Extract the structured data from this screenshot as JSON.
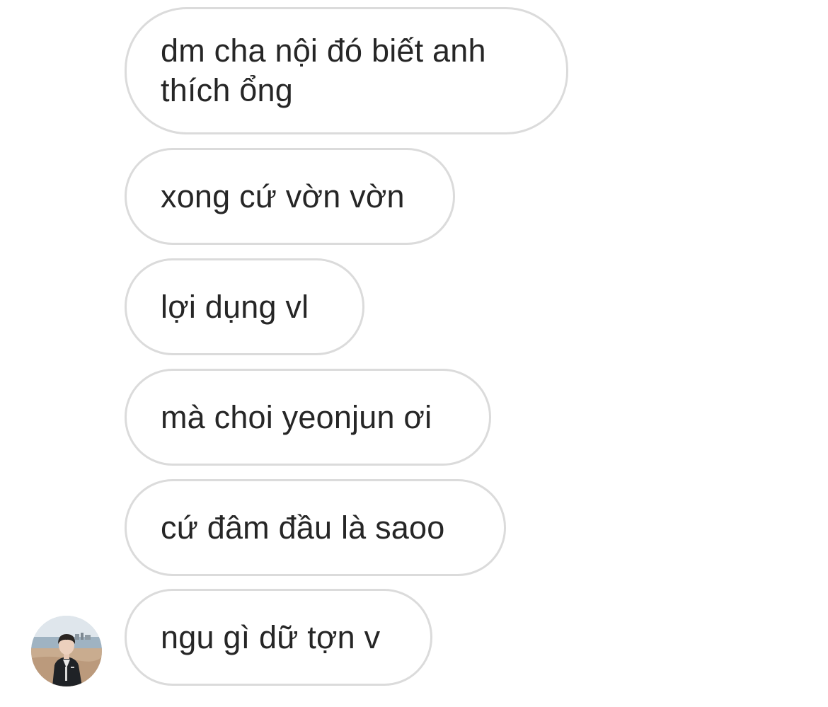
{
  "conversation": {
    "messages": [
      {
        "text": "dm cha nội đó biết anh thích ổng"
      },
      {
        "text": "xong cứ vờn vờn"
      },
      {
        "text": "lợi dụng vl"
      },
      {
        "text": "mà choi yeonjun ơi"
      },
      {
        "text": "cứ đâm đầu là saoo"
      },
      {
        "text": "ngu gì dữ tợn v"
      }
    ],
    "avatar": {
      "icon": "user-avatar-photo"
    }
  },
  "colors": {
    "bubble_border": "#dbdbdb",
    "text": "#262626",
    "background": "#ffffff"
  }
}
